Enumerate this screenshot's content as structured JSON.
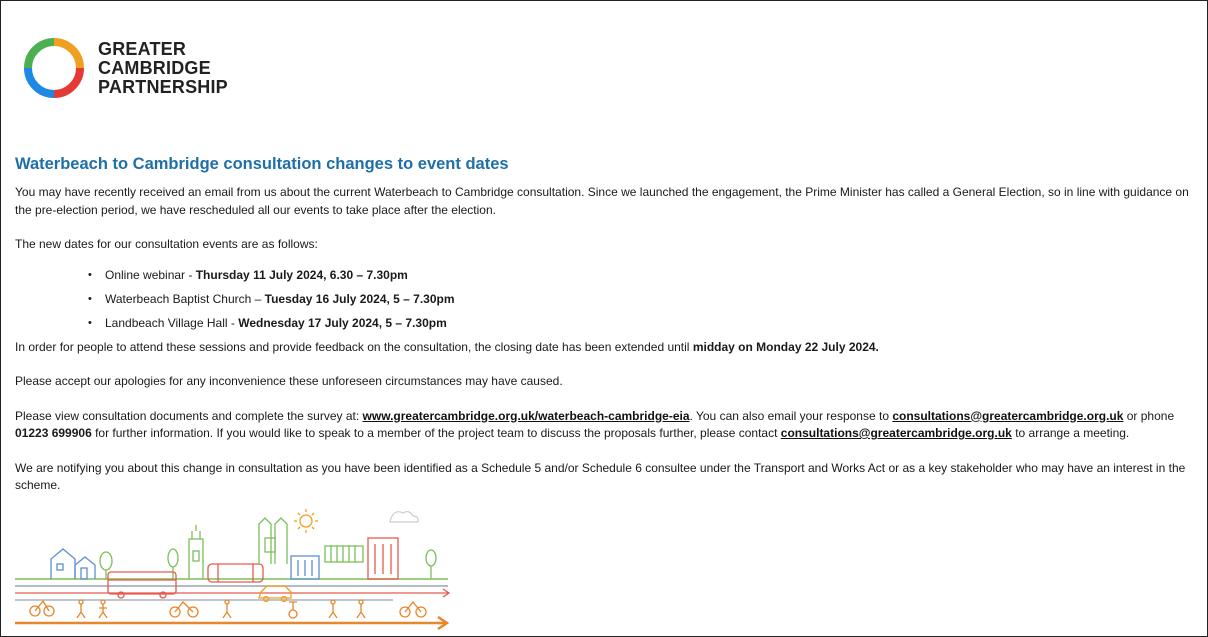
{
  "logo": {
    "lines": [
      "GREATER",
      "CAMBRIDGE",
      "PARTNERSHIP"
    ],
    "colors": [
      "#f0a020",
      "#4caf50",
      "#1e88e5",
      "#e53935"
    ]
  },
  "heading": "Waterbeach to Cambridge consultation changes to event dates",
  "intro": "You may have recently received an email from us about the current Waterbeach to Cambridge consultation. Since we launched the engagement, the Prime Minister has called a General Election, so in line with guidance on the pre-election period, we have rescheduled all our events to take place after the election.",
  "new_dates_intro": "The new dates for our consultation events are as follows:",
  "events": [
    {
      "place": "Online webinar - ",
      "when": "Thursday 11 July 2024, 6.30 – 7.30pm"
    },
    {
      "place": "Waterbeach Baptist Church – ",
      "when": "Tuesday 16 July 2024, 5 – 7.30pm"
    },
    {
      "place": "Landbeach Village Hall - ",
      "when": "Wednesday 17 July 2024, 5 – 7.30pm"
    }
  ],
  "closing": {
    "text": "In order for people to attend these sessions and provide feedback on the consultation, the closing date has been extended until ",
    "date": "midday on Monday 22 July 2024."
  },
  "apology": "Please accept our apologies for any inconvenience these unforeseen circumstances may have caused.",
  "view": {
    "t1": "Please view consultation documents and complete the survey at: ",
    "link_url": "www.greatercambridge.org.uk/waterbeach-cambridge-eia",
    "t2": ". You can also email your response to ",
    "email1": "consultations@greatercambridge.org.uk",
    "t3": " or phone ",
    "phone": "01223 699906",
    "t4": " for further information.  If you would like to speak to a member of the project team to discuss the proposals further, please contact ",
    "email2": "consultations@greatercambridge.org.uk",
    "t5": " to arrange a meeting."
  },
  "notice": "We are notifying you about this change in consultation as you have been identified as a Schedule 5 and/or Schedule 6 consultee under the Transport and Works Act or as a key stakeholder who may have an interest in the scheme.",
  "colors": {
    "heading": "#1f6fa8",
    "illustration_orange": "#e8862a",
    "illustration_grey": "#9aa5b1",
    "illustration_green": "#7cbf5a",
    "illustration_red": "#e45a4c",
    "illustration_blue": "#5b8fd1"
  }
}
